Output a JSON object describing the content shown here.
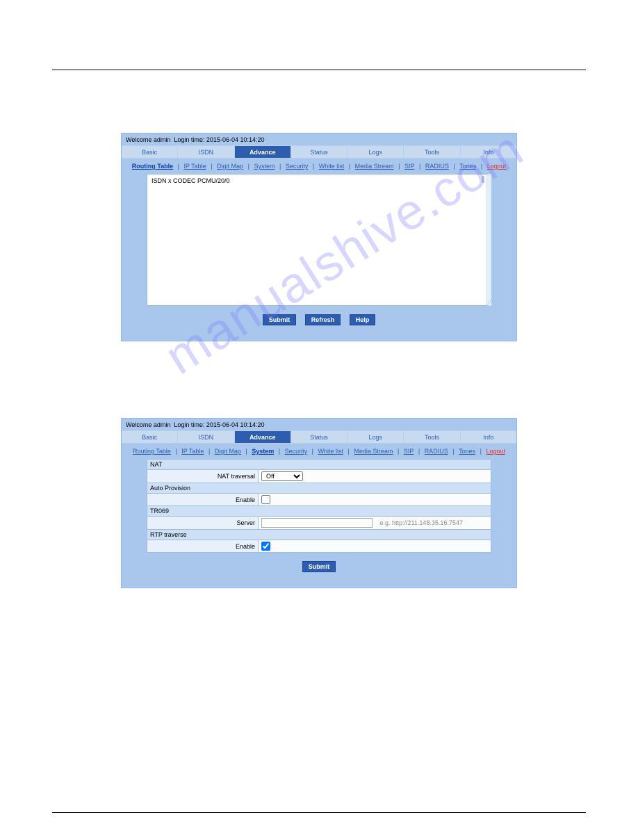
{
  "watermark": "manualshive.com",
  "header": {
    "welcome_prefix": "Welcome ",
    "user": "admin",
    "login_label": "Login time: ",
    "login_time": "2015-06-04 10:14:20"
  },
  "tabs": [
    "Basic",
    "ISDN",
    "Advance",
    "Status",
    "Logs",
    "Tools",
    "Info"
  ],
  "panel1": {
    "active_tab_index": 2,
    "subnav": [
      "Routing Table",
      "IP Table",
      "Digit Map",
      "System",
      "Security",
      "White list",
      "Media Stream",
      "SIP",
      "RADIUS",
      "Tones",
      "Logout"
    ],
    "subnav_selected_index": 0,
    "textarea_content": "ISDN x      CODEC    PCMU/20/0",
    "buttons": {
      "submit": "Submit",
      "refresh": "Refresh",
      "help": "Help"
    }
  },
  "panel2": {
    "active_tab_index": 2,
    "subnav": [
      "Routing Table",
      "IP Table",
      "Digit Map",
      "System",
      "Security",
      "White list",
      "Media Stream",
      "SIP",
      "RADIUS",
      "Tones",
      "Logout"
    ],
    "subnav_selected_index": 3,
    "sections": {
      "nat": {
        "title": "NAT",
        "field_label": "NAT traversal",
        "value": "Off",
        "options": [
          "Off"
        ]
      },
      "auto_provision": {
        "title": "Auto Provision",
        "field_label": "Enable",
        "checked": false
      },
      "tr069": {
        "title": "TR069",
        "field_label": "Server",
        "value": "",
        "hint": "e.g. http://211.148.35.16:7547"
      },
      "rtp_traverse": {
        "title": "RTP traverse",
        "field_label": "Enable",
        "checked": true
      }
    },
    "buttons": {
      "submit": "Submit"
    }
  }
}
